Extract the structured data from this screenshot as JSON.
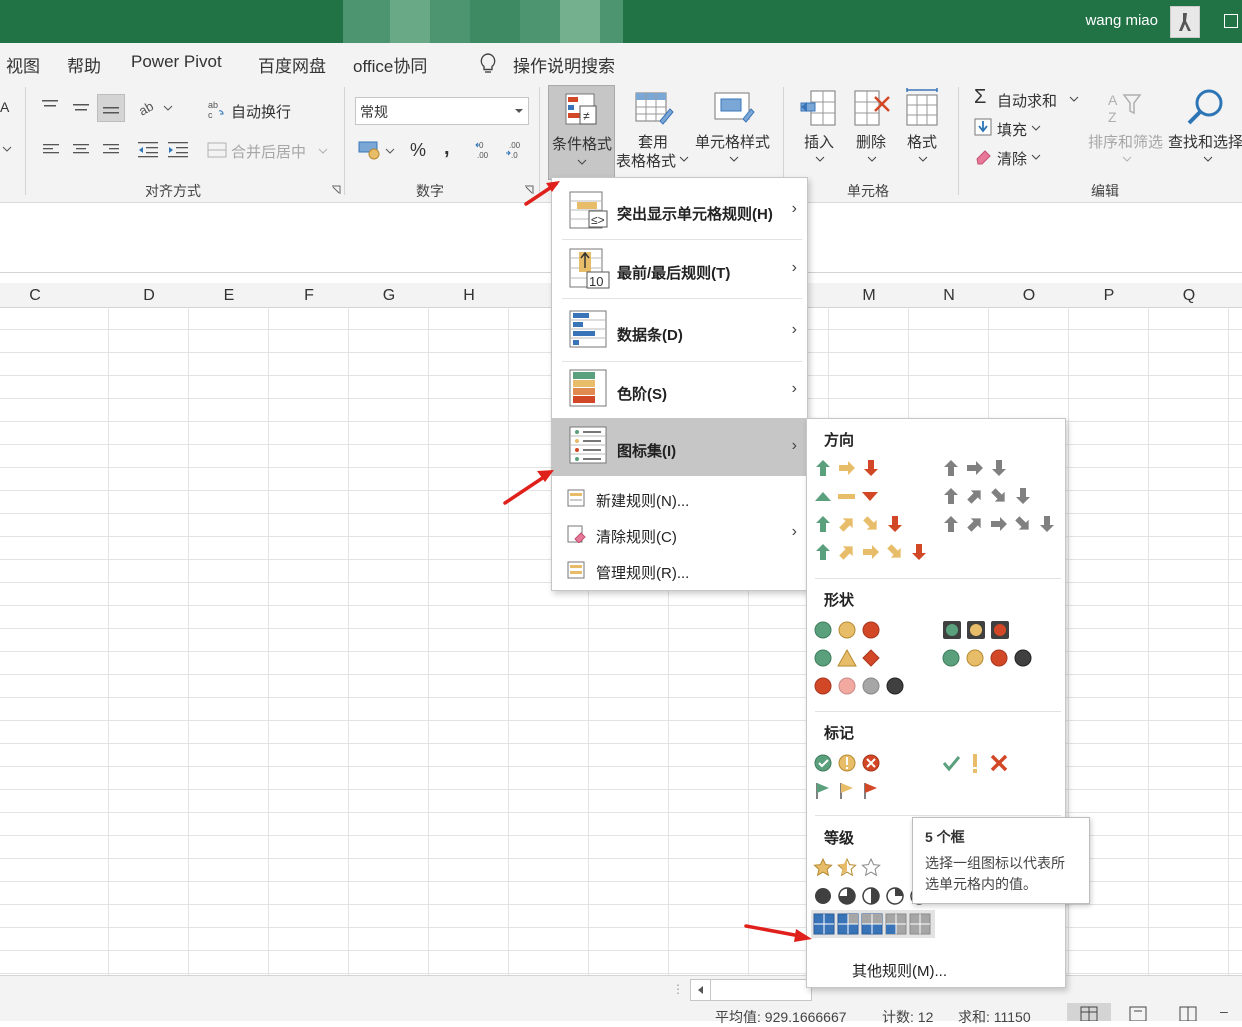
{
  "titlebar": {
    "user_name": "wang miao"
  },
  "menubar": {
    "items": [
      "视图",
      "帮助",
      "Power Pivot",
      "百度网盘",
      "office协同"
    ],
    "search_label": "操作说明搜索"
  },
  "ribbon": {
    "alignment": {
      "wrap_text": "自动换行",
      "merge_center": "合并后居中",
      "group_label": "对齐方式"
    },
    "number": {
      "format_value": "常规",
      "percent": "%",
      "comma": ",",
      "group_label": "数字"
    },
    "styles": {
      "conditional_format": "条件格式",
      "format_as_table_1": "套用",
      "format_as_table_2": "表格格式",
      "cell_styles": "单元格样式"
    },
    "cells": {
      "insert": "插入",
      "delete": "删除",
      "format": "格式",
      "group_label": "单元格"
    },
    "editing": {
      "autosum": "自动求和",
      "fill": "填充",
      "clear": "清除",
      "sort_filter": "排序和筛选",
      "find_select": "查找和选择",
      "group_label": "编辑"
    }
  },
  "columns": [
    "C",
    "D",
    "E",
    "F",
    "G",
    "H",
    "M",
    "N",
    "O",
    "P",
    "Q"
  ],
  "cf_menu": {
    "highlight_rules": "突出显示单元格规则(H)",
    "top_bottom": "最前/最后规则(T)",
    "data_bars": "数据条(D)",
    "color_scales": "色阶(S)",
    "icon_sets": "图标集(I)",
    "new_rule": "新建规则(N)...",
    "clear_rules": "清除规则(C)",
    "manage_rules": "管理规则(R)...",
    "top_bottom_badge": "10"
  },
  "icon_sets": {
    "directional": "方向",
    "shapes": "形状",
    "indicators": "标记",
    "ratings": "等级",
    "more_rules": "其他规则(M)..."
  },
  "tooltip": {
    "title": "5 个框",
    "body_line1": "选择一组图标以代表所",
    "body_line2": "选单元格内的值。"
  },
  "statusbar": {
    "average": "平均值: 929.1666667",
    "count": "计数: 12",
    "sum": "求和: 11150"
  },
  "colors": {
    "excel_green": "#217346",
    "icon_green": "#5ba07d",
    "icon_yellow": "#e8bd6a",
    "icon_red": "#d24726",
    "icon_gray": "#8c8c8c",
    "icon_dark": "#404040",
    "box_blue": "#3a74b8",
    "arrow_red": "#e0201b"
  }
}
